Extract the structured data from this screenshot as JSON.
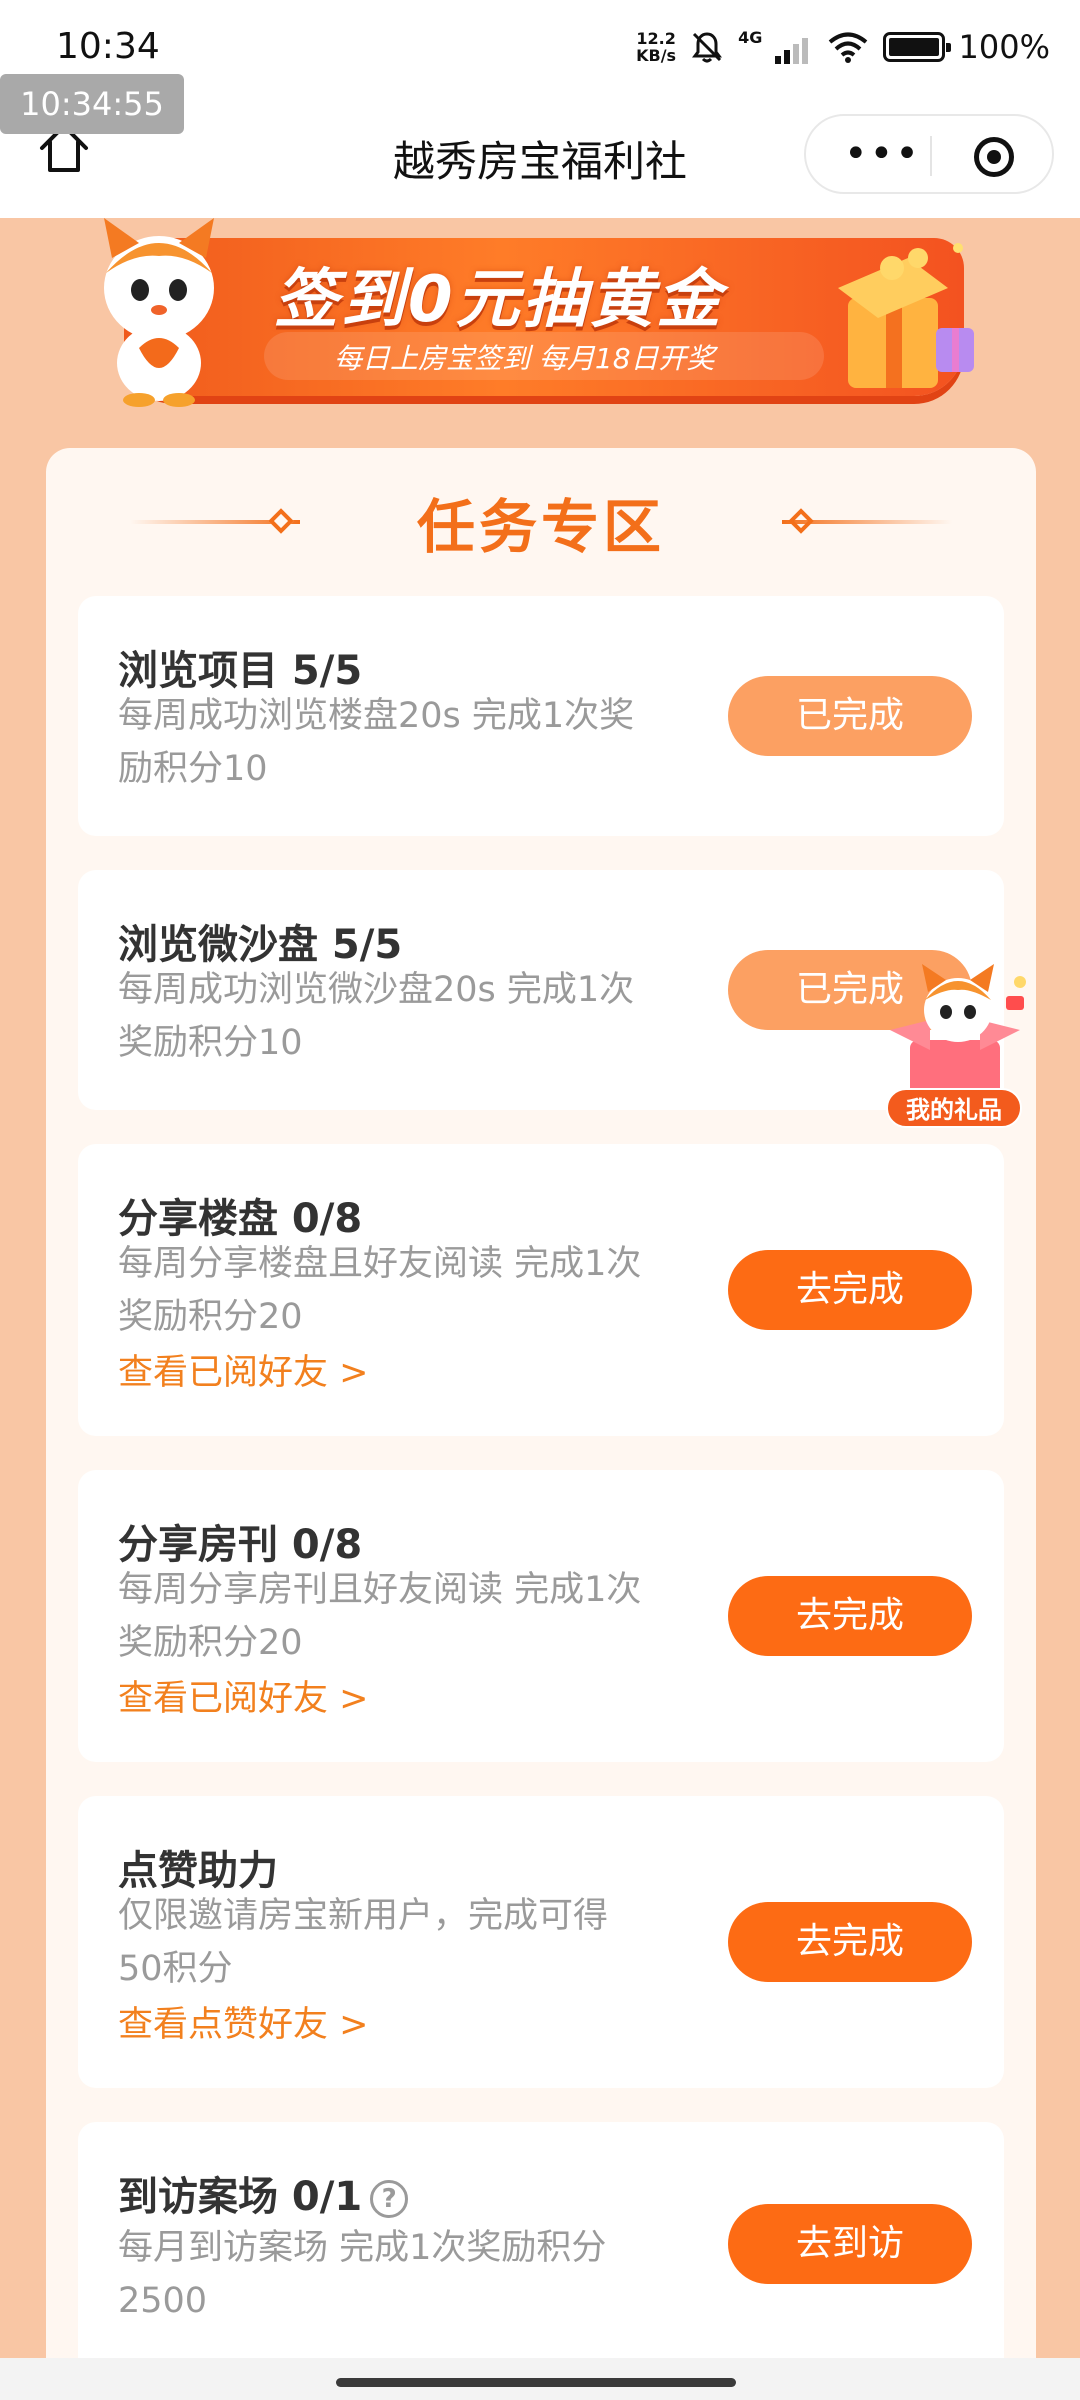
{
  "status_bar": {
    "time": "10:34",
    "net_speed_top": "12.2",
    "net_speed_bottom": "KB/s",
    "network": "4G",
    "battery": "100%",
    "battery_level": 1.0
  },
  "overlay_clock": "10:34:55",
  "nav": {
    "title": "越秀房宝福利社"
  },
  "banner": {
    "title": "签到0元抽黄金",
    "subtitle": "每日上房宝签到  每月18日开奖"
  },
  "section": {
    "title": "任务专区"
  },
  "tasks": [
    {
      "name": "浏览项目 5/5",
      "desc_line1": "每周成功浏览楼盘20s 完成1次奖",
      "desc_line2": "励积分10",
      "link": "",
      "button": "已完成",
      "status": "done"
    },
    {
      "name": "浏览微沙盘 5/5",
      "desc_line1": "每周成功浏览微沙盘20s 完成1次",
      "desc_line2": "奖励积分10",
      "link": "",
      "button": "已完成",
      "status": "done"
    },
    {
      "name": "分享楼盘 0/8",
      "desc_line1": "每周分享楼盘且好友阅读 完成1次",
      "desc_line2": "奖励积分20",
      "link": "查看已阅好友 >",
      "button": "去完成",
      "status": "todo"
    },
    {
      "name": "分享房刊 0/8",
      "desc_line1": "每周分享房刊且好友阅读 完成1次",
      "desc_line2": "奖励积分20",
      "link": "查看已阅好友 >",
      "button": "去完成",
      "status": "todo"
    },
    {
      "name": "点赞助力",
      "desc_line1": "仅限邀请房宝新用户，完成可得",
      "desc_line2": "50积分",
      "link": "查看点赞好友 >",
      "button": "去完成",
      "status": "todo"
    },
    {
      "name": "到访案场 0/1",
      "desc_line1": "每月到访案场 完成1次奖励积分",
      "desc_line2": "2500",
      "link": "",
      "button": "去到访",
      "status": "todo"
    }
  ],
  "floating_gift": {
    "label": "我的礼品"
  },
  "colors": {
    "page_bg": "#f9c6a4",
    "accent": "#fd6b14",
    "done_button": "#fca062",
    "link": "#f2801e"
  }
}
